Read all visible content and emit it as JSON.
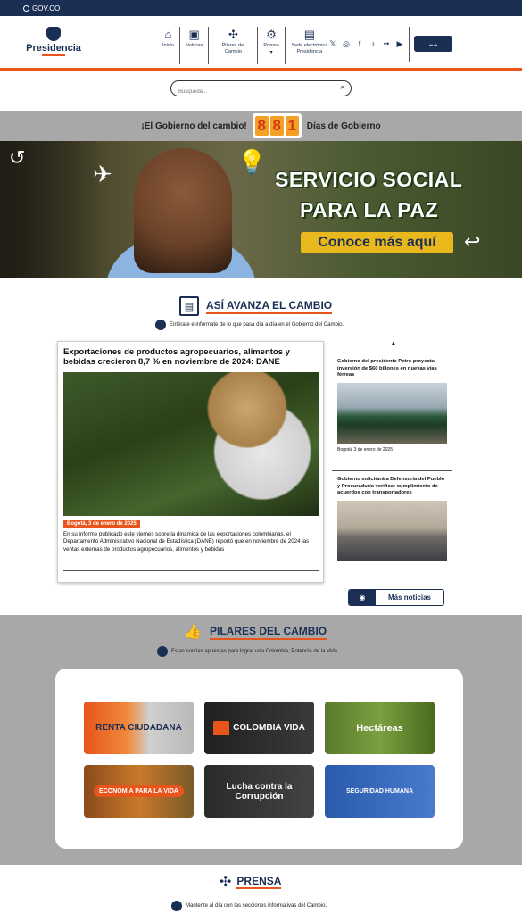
{
  "govbar": {
    "label": "GOV.CO"
  },
  "header": {
    "logo_text": "Presidencia",
    "nav": [
      {
        "icon": "home-icon",
        "glyph": "⌂",
        "label": "Inicio"
      },
      {
        "icon": "news-icon",
        "glyph": "▣",
        "label": "Noticias"
      },
      {
        "icon": "pillars-icon",
        "glyph": "✣",
        "label": "Pilares del Cambio"
      },
      {
        "icon": "press-icon",
        "glyph": "⚙",
        "label": "Prensa"
      },
      {
        "icon": "e-office-icon",
        "glyph": "▤",
        "label": "Sede electrónica Presidencia"
      }
    ],
    "social": [
      "𝕏",
      "◎",
      "f",
      "♪",
      "••",
      "▶"
    ]
  },
  "search": {
    "placeholder": "Búsqueda..."
  },
  "counter": {
    "left_text": "¡El Gobierno del cambio!",
    "digits": [
      "8",
      "8",
      "1"
    ],
    "right_text": "Días de Gobierno"
  },
  "banner": {
    "line1": "SERVICIO SOCIAL",
    "line2": "PARA LA PAZ",
    "cta": "Conoce más aquí"
  },
  "avanza": {
    "title": "ASÍ AVANZA EL CAMBIO",
    "subtitle": "Entérate e infórmate de lo que pasa día a día en el Gobierno del Cambio.",
    "main": {
      "headline": "Exportaciones de productos agropecuarios, alimentos y bebidas crecieron 8,7 % en noviembre de 2024: DANE",
      "date": "Bogotá, 3 de enero de 2025",
      "body": "En su informe publicado este viernes sobre la dinámica de las exportaciones colombianas, el Departamento Administrativo Nacional de Estadística (DANE) reportó que en noviembre de 2024 las ventas externas de productos agropecuarios, alimentos y bebidas"
    },
    "side": [
      {
        "headline": "Gobierno del presidente Petro proyecta inversión de $60 billones en nuevas vías férreas",
        "date": "Bogotá, 3 de enero de 2025"
      },
      {
        "headline": "Gobierno solicitará a Defensoría del Pueblo y Procuraduría verificar cumplimiento de acuerdos con transportadores",
        "date": ""
      }
    ],
    "more_label": "Más noticias"
  },
  "pilares": {
    "title": "PILARES DEL CAMBIO",
    "subtitle": "Estas son las apuestas para lograr una Colombia, Potencia de la Vida.",
    "tiles": [
      "RENTA CIUDADANA",
      "COLOMBIA VIDA",
      "Hectáreas",
      "ECONOMÍA PARA LA VIDA",
      "Lucha contra la Corrupción",
      "SEGURIDAD HUMANA"
    ]
  },
  "prensa": {
    "title": "PRENSA",
    "subtitle": "Mantente al día con las secciones informativas del Cambio."
  }
}
